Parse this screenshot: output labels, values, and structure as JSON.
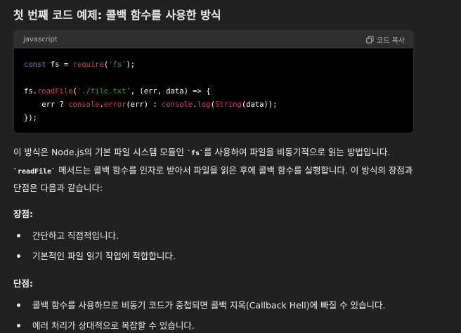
{
  "title": "첫 번째 코드 예제: 콜백 함수를 사용한 방식",
  "code_block": {
    "language": "javascript",
    "copy_label": "코드 복사",
    "copy_icon": "copy-icon",
    "lines": [
      [
        {
          "t": "const",
          "c": "kw"
        },
        {
          "t": " fs = "
        },
        {
          "t": "require",
          "c": "fn"
        },
        {
          "t": "("
        },
        {
          "t": "'fs'",
          "c": "str"
        },
        {
          "t": ");"
        }
      ],
      [],
      [
        {
          "t": "fs."
        },
        {
          "t": "readFile",
          "c": "fn"
        },
        {
          "t": "("
        },
        {
          "t": "'./file.txt'",
          "c": "str"
        },
        {
          "t": ", (err, data) => {"
        }
      ],
      [
        {
          "t": "    err ? "
        },
        {
          "t": "console",
          "c": "fn"
        },
        {
          "t": "."
        },
        {
          "t": "error",
          "c": "fn"
        },
        {
          "t": "(err) : "
        },
        {
          "t": "console",
          "c": "fn"
        },
        {
          "t": "."
        },
        {
          "t": "log",
          "c": "fn"
        },
        {
          "t": "("
        },
        {
          "t": "String",
          "c": "fn"
        },
        {
          "t": "(data));"
        }
      ],
      [
        {
          "t": "});"
        }
      ]
    ]
  },
  "description": {
    "part1": "이 방식은 Node.js의 기본 파일 시스템 모듈인 ",
    "code1": "`fs`",
    "part2": "를 사용하여 파일을 비동기적으로 읽는 방법입니다. ",
    "code2": "`readFile`",
    "part3": " 메서드는 콜백 함수를 인자로 받아서 파일을 읽은 후에 콜백 함수를 실행합니다. 이 방식의 장점과 단점은 다음과 같습니다:"
  },
  "pros": {
    "label": "장점:",
    "items": [
      "간단하고 직접적입니다.",
      "기본적인 파일 읽기 작업에 적합합니다."
    ]
  },
  "cons": {
    "label": "단점:",
    "items": [
      "콜백 함수를 사용하므로 비동기 코드가 중첩되면 콜백 지옥(Callback Hell)에 빠질 수 있습니다.",
      "에러 처리가 상대적으로 복잡할 수 있습니다."
    ]
  },
  "colors": {
    "background": "#212121",
    "code_background": "#000000",
    "code_header": "#2f2f2f",
    "keyword": "#2e95d3",
    "function": "#df3079",
    "string": "#00a67d"
  }
}
